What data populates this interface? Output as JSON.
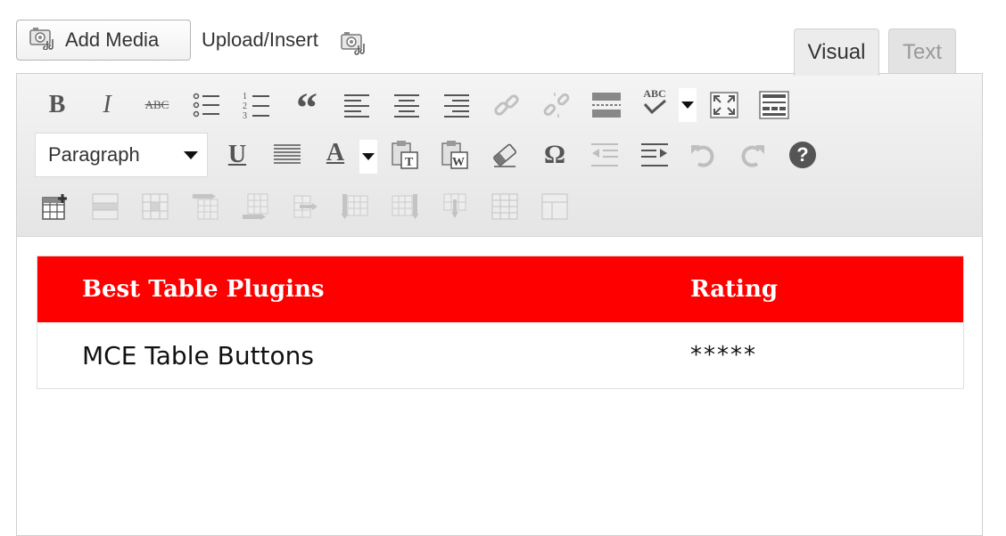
{
  "media": {
    "add_media_label": "Add Media",
    "upload_insert_label": "Upload/Insert"
  },
  "tabs": [
    {
      "label": "Visual",
      "active": true
    },
    {
      "label": "Text",
      "active": false
    }
  ],
  "toolbar": {
    "row1": [
      "bold-icon",
      "italic-icon",
      "strikethrough-icon",
      "bullet-list-icon",
      "numbered-list-icon",
      "blockquote-icon",
      "align-left-icon",
      "align-center-icon",
      "align-right-icon",
      "insert-link-icon",
      "unlink-icon",
      "insert-more-icon",
      "spellcheck-icon",
      "fullscreen-icon",
      "toggle-toolbar-icon"
    ],
    "row2": [
      "underline-icon",
      "align-justify-icon",
      "text-color-icon",
      "paste-text-icon",
      "paste-word-icon",
      "clear-formatting-icon",
      "special-character-icon",
      "outdent-icon",
      "indent-icon",
      "undo-icon",
      "redo-icon",
      "help-icon"
    ],
    "row3": [
      "insert-table-icon",
      "row-properties-icon",
      "cell-properties-icon",
      "insert-row-before-icon",
      "insert-row-after-icon",
      "delete-row-icon",
      "insert-col-before-icon",
      "insert-col-after-icon",
      "delete-col-icon",
      "split-cells-icon",
      "merge-cells-icon"
    ],
    "format_select_value": "Paragraph",
    "bold_glyph": "B",
    "italic_glyph": "I",
    "strike_glyph": "ABC",
    "quote_glyph": "“",
    "underline_glyph": "U",
    "color_glyph": "A",
    "omega_glyph": "Ω",
    "spell_glyph": "ABC",
    "help_glyph": "?",
    "text_color_bar": "#555555"
  },
  "table": {
    "header_bg": "#ff0000",
    "headers": [
      "Best Table Plugins",
      "Rating"
    ],
    "rows": [
      [
        "MCE Table Buttons",
        "*****"
      ]
    ]
  }
}
